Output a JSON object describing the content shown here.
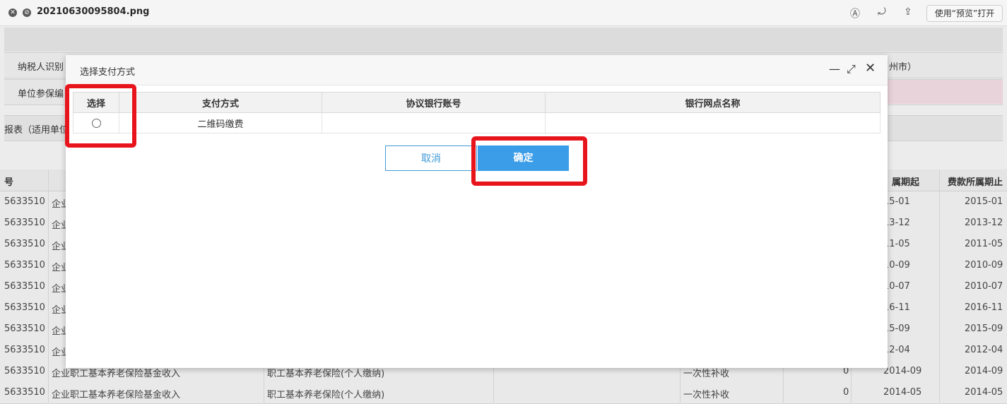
{
  "titlebar": {
    "filename": "20210630095804.png",
    "open_with": "使用“预览”打开"
  },
  "background": {
    "info_rows": [
      "纳税人识别",
      "单位参保编",
      "报表（适用单位"
    ],
    "city_text": "州市）",
    "table_headers": {
      "first": "号",
      "period_start": "属期起",
      "period_end": "费款所属期止"
    },
    "rows": [
      {
        "id": "5633510",
        "type": "企业",
        "desc": "",
        "kind": "",
        "amount": "",
        "start": "15-01",
        "end": "2015-01"
      },
      {
        "id": "5633510",
        "type": "企业",
        "desc": "",
        "kind": "",
        "amount": "",
        "start": "13-12",
        "end": "2013-12"
      },
      {
        "id": "5633510",
        "type": "企业",
        "desc": "",
        "kind": "",
        "amount": "",
        "start": "11-05",
        "end": "2011-05"
      },
      {
        "id": "5633510",
        "type": "企业",
        "desc": "",
        "kind": "",
        "amount": "",
        "start": "10-09",
        "end": "2010-09"
      },
      {
        "id": "5633510",
        "type": "企业",
        "desc": "",
        "kind": "",
        "amount": "",
        "start": "10-07",
        "end": "2010-07"
      },
      {
        "id": "5633510",
        "type": "企业",
        "desc": "",
        "kind": "",
        "amount": "",
        "start": "16-11",
        "end": "2016-11"
      },
      {
        "id": "5633510",
        "type": "企业",
        "desc": "",
        "kind": "",
        "amount": "",
        "start": "15-09",
        "end": "2015-09"
      },
      {
        "id": "5633510",
        "type": "企业",
        "desc": "",
        "kind": "",
        "amount": "",
        "start": "12-04",
        "end": "2012-04"
      },
      {
        "id": "5633510",
        "type": "企业职工基本养老保险基金收入",
        "desc": "职工基本养老保险(个人缴纳)",
        "kind": "一次性补收",
        "amount": "0",
        "start": "2014-09",
        "end": "2014-09"
      },
      {
        "id": "5633510",
        "type": "企业职工基本养老保险基金收入",
        "desc": "职工基本养老保险(个人缴纳)",
        "kind": "一次性补收",
        "amount": "0",
        "start": "2014-05",
        "end": "2014-05"
      }
    ]
  },
  "modal": {
    "title": "选择支付方式",
    "columns": [
      "选择",
      "支付方式",
      "协议银行账号",
      "银行网点名称"
    ],
    "rows": [
      {
        "method": "二维码缴费",
        "account": "",
        "branch": ""
      }
    ],
    "cancel_label": "取消",
    "ok_label": "确定"
  },
  "colors": {
    "accent": "#3b9de8",
    "annotation": "#e8141c"
  }
}
